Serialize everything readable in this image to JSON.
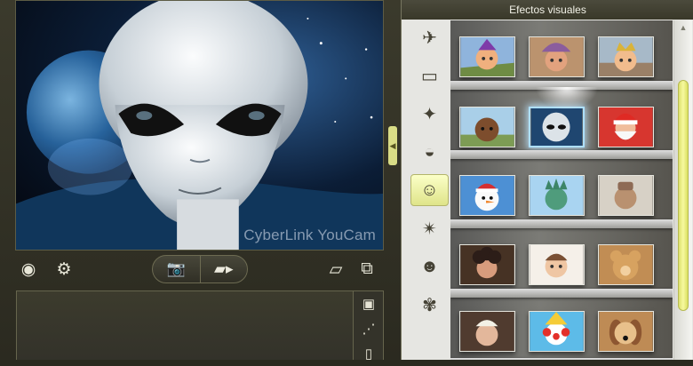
{
  "app": {
    "watermark": "CyberLink YouCam",
    "accent_color": "#e5e78d"
  },
  "toolbar": {
    "visibility_icon": "eye-icon",
    "settings_icon": "gear-icon",
    "photo_icon": "camera-icon",
    "video_icon": "video-camera-icon",
    "eraser_icon": "eraser-icon",
    "window_icon": "window-swap-icon"
  },
  "media_side": {
    "icons": [
      "portrait-icon",
      "share-icon",
      "trash-icon"
    ]
  },
  "effects": {
    "title": "Efectos visuales",
    "categories": [
      {
        "icon": "scene-icon"
      },
      {
        "icon": "frame-icon"
      },
      {
        "icon": "magic-wand-icon"
      },
      {
        "icon": "mask-icon"
      },
      {
        "icon": "avatar-face-icon",
        "active": true
      },
      {
        "icon": "emotion-icon"
      },
      {
        "icon": "smiley-icon"
      },
      {
        "icon": "gadget-icon"
      }
    ],
    "rows": [
      [
        "purple-hair-avatar",
        "hat-girl-avatar",
        "crown-king-avatar"
      ],
      [
        "dark-face-avatar",
        "alien-avatar",
        "santa-avatar"
      ],
      [
        "snowman-avatar",
        "liberty-statue-avatar",
        "terracotta-warrior-avatar"
      ],
      [
        "curly-woman-avatar",
        "cartoon-boy-avatar",
        "teddy-bear-avatar"
      ],
      [
        "blonde-man-avatar",
        "clown-avatar",
        "dog-avatar"
      ]
    ],
    "selected": "alien-avatar"
  }
}
